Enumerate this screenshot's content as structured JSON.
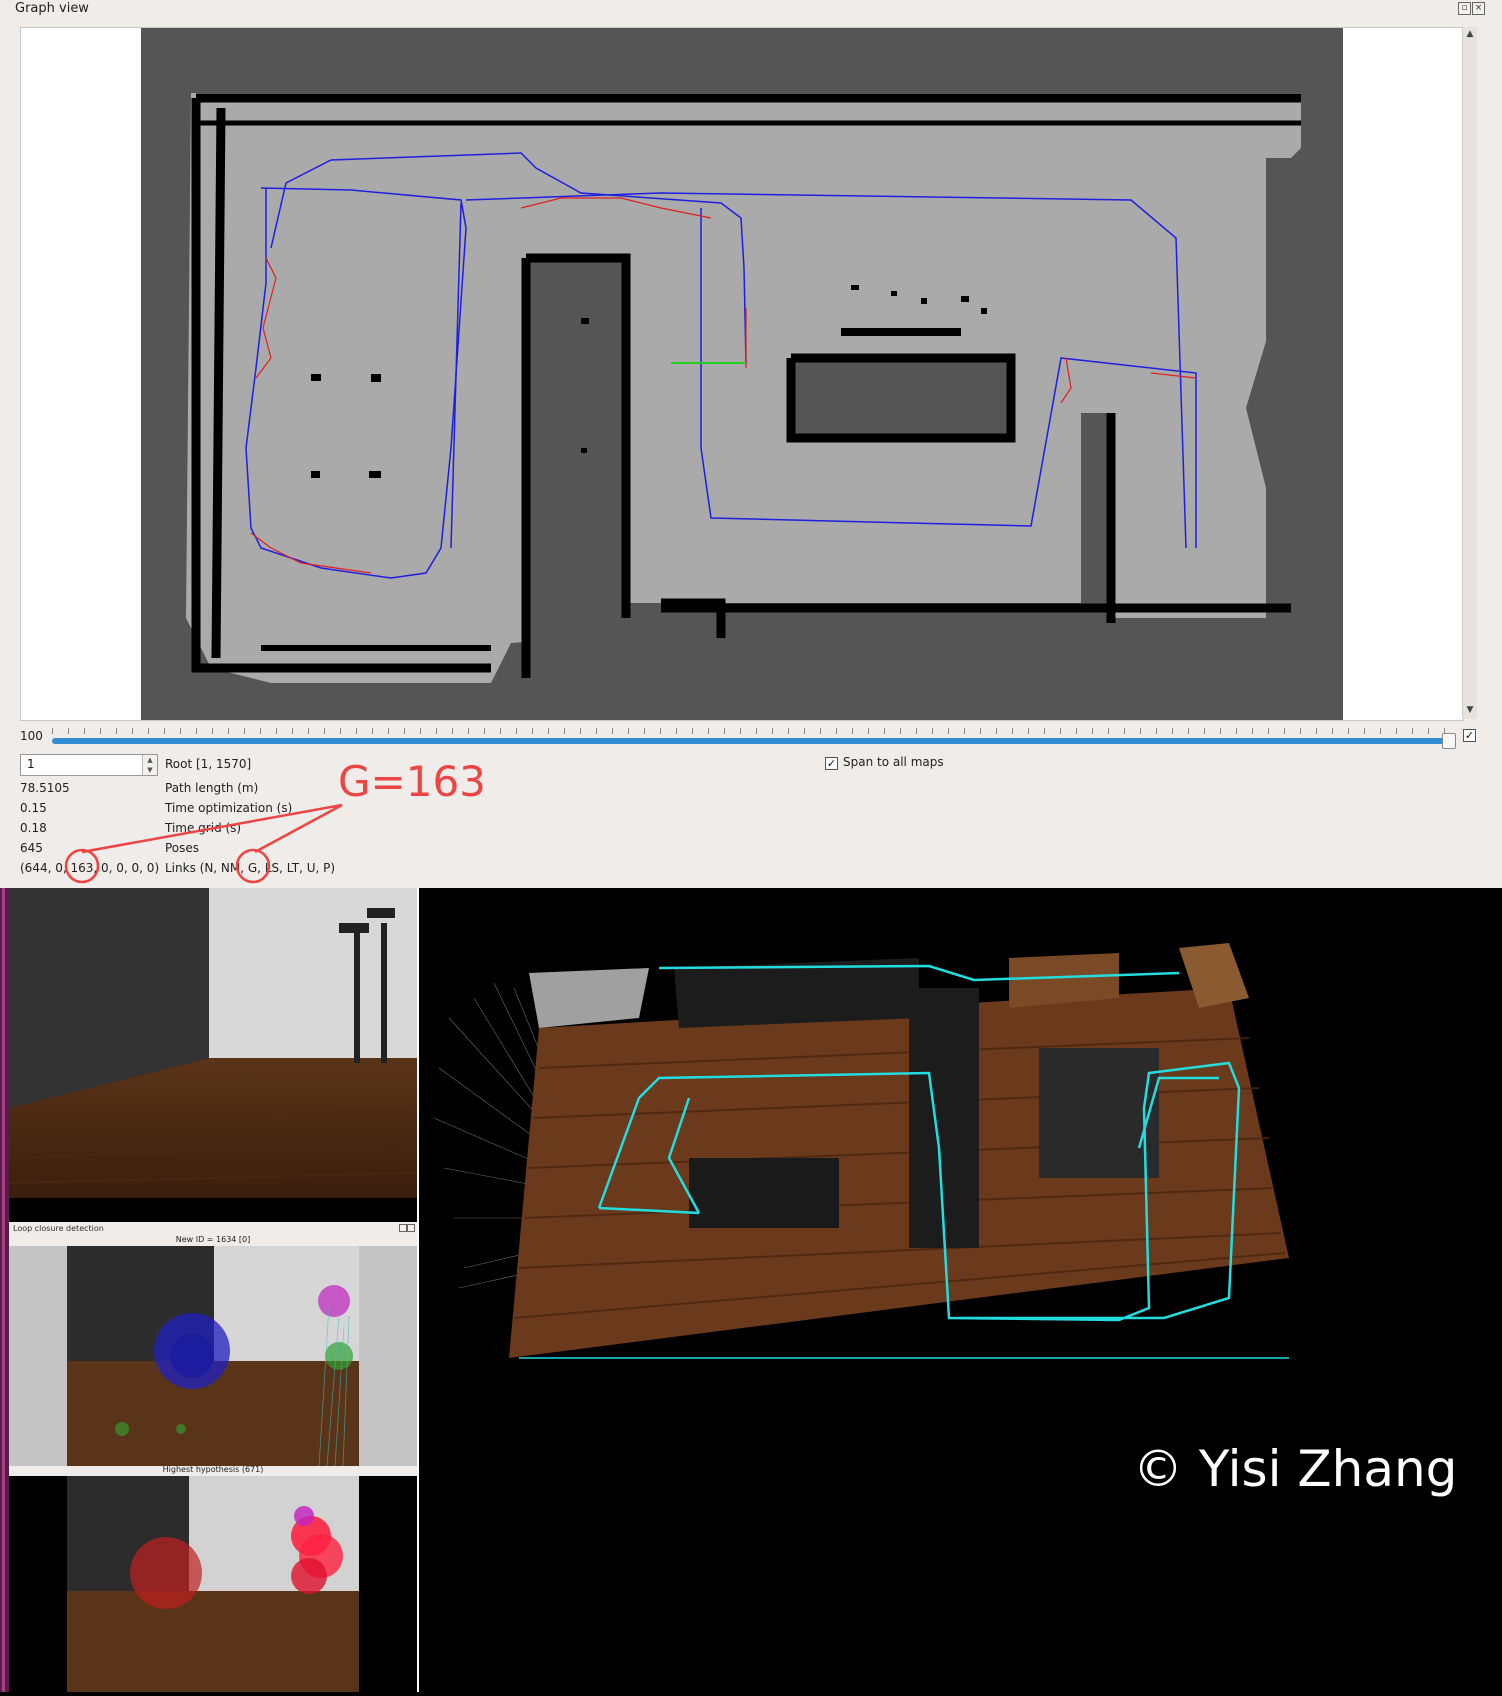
{
  "window": {
    "title": "Graph view"
  },
  "slider": {
    "value": "100"
  },
  "root": {
    "spin_value": "1",
    "label": "Root [1, 1570]"
  },
  "span_all_maps": {
    "label": "Span to all maps",
    "checked": true
  },
  "stats": [
    {
      "value": "78.5105",
      "label": "Path length (m)"
    },
    {
      "value": "0.15",
      "label": "Time optimization (s)"
    },
    {
      "value": "0.18",
      "label": "Time grid (s)"
    },
    {
      "value": "645",
      "label": "Poses"
    },
    {
      "value": "(644, 0, 163, 0, 0, 0, 0)",
      "label": "Links (N, NM, G, LS, LT, U, P)"
    }
  ],
  "annotation": {
    "text": "G=163",
    "color": "#ee4444"
  },
  "loop_closure": {
    "title": "Loop closure detection",
    "new_id": "New ID = 1634 [0]",
    "hypothesis": "Highest hypothesis (671)"
  },
  "copyright": "© Yisi Zhang",
  "colors": {
    "map_unknown": "#555555",
    "map_free": "#aaaaaa",
    "obstacle": "#000000",
    "graph_path": "#1f1fe0",
    "loop_links": "#e02020",
    "trajectory_3d": "#22dde0",
    "floor": "#6b3a1c"
  },
  "icons": [
    "float-icon",
    "close-icon",
    "scroll-up-icon",
    "scroll-down-icon",
    "check-icon"
  ]
}
